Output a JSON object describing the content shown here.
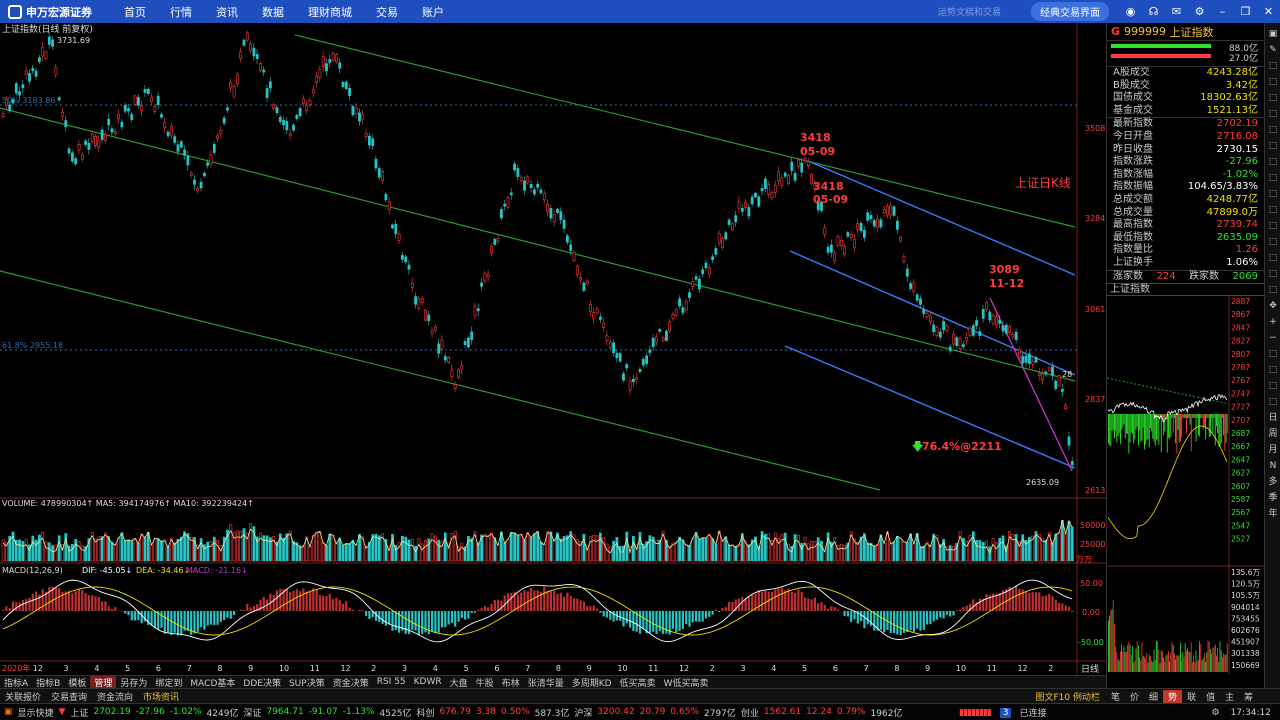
{
  "nav": {
    "logo": "申万宏源证券",
    "items": [
      "首页",
      "行情",
      "资讯",
      "数据",
      "理财商城",
      "交易",
      "账户"
    ],
    "hint": "运势文稿和交易",
    "classic_button": "经典交易界面",
    "icons": [
      "app-icon",
      "headset-icon",
      "mail-icon",
      "gear-icon",
      "minimize-icon",
      "restore-icon",
      "close-icon"
    ]
  },
  "chart": {
    "title": "上证指数(日线 前复权)",
    "high_label": "3731.69",
    "low_label": "2635.09",
    "fib50_label": "50% 3183.86",
    "fib618_label": "61.8% 2955.18",
    "right_title": "上证日K线",
    "ann1": {
      "value": "3418",
      "date": "05-09"
    },
    "ann2": {
      "value": "3418",
      "date": "05-09"
    },
    "ann3": {
      "value": "3089",
      "date": "11-12"
    },
    "fib_target": "76.4%@2211",
    "edge_label": "28",
    "y_ticks": [
      "3508",
      "3284",
      "3061",
      "2837",
      "2613"
    ],
    "x_ticks": [
      "2020年",
      "12",
      "3",
      "4",
      "5",
      "6",
      "7",
      "8",
      "9",
      "10",
      "11",
      "12",
      "2",
      "3",
      "4",
      "5",
      "6",
      "7",
      "8",
      "9",
      "10",
      "11",
      "12",
      "2",
      "3",
      "4",
      "5",
      "6",
      "7",
      "8",
      "9",
      "10",
      "11",
      "12",
      "2"
    ],
    "period": "日线"
  },
  "volume": {
    "header": "VOLUME: 478990304↑  MA5: 394174976↑  MA10: 392239424↑",
    "y_ticks": [
      "50000",
      "25000"
    ],
    "unit": "万万"
  },
  "macd": {
    "header_name": "MACD(12,26,9)",
    "dif": "DIF: -45.05↓",
    "dea": "DEA: -34.46↓",
    "macd": "MACD: -21.16↓",
    "y_ticks": [
      "50.00",
      "0.00",
      "-50.00"
    ]
  },
  "right_panel": {
    "code": "999999",
    "name": "上证指数",
    "bar_pct1": "88.0亿",
    "bar_pct2": "27.0亿",
    "turnover": [
      {
        "k": "A股成交",
        "v": "4243.28亿"
      },
      {
        "k": "B股成交",
        "v": "3.42亿"
      },
      {
        "k": "国债成交",
        "v": "18302.63亿"
      },
      {
        "k": "基金成交",
        "v": "1521.13亿"
      }
    ],
    "quote": [
      {
        "k": "最新指数",
        "v": "2702.19",
        "c": "red"
      },
      {
        "k": "今日开盘",
        "v": "2716.08",
        "c": "red"
      },
      {
        "k": "昨日收盘",
        "v": "2730.15",
        "c": "white"
      },
      {
        "k": "指数涨跌",
        "v": "-27.96",
        "c": "green"
      },
      {
        "k": "指数涨幅",
        "v": "-1.02%",
        "c": "green"
      },
      {
        "k": "指数振幅",
        "v": "104.65/3.83%",
        "c": "white"
      },
      {
        "k": "总成交额",
        "v": "4248.77亿",
        "c": "yellow"
      },
      {
        "k": "总成交量",
        "v": "47899.0万",
        "c": "yellow"
      },
      {
        "k": "最高指数",
        "v": "2739.74",
        "c": "red"
      },
      {
        "k": "最低指数",
        "v": "2635.09",
        "c": "green"
      },
      {
        "k": "指数量比",
        "v": "1.26",
        "c": "red"
      },
      {
        "k": "上证换手",
        "v": "1.06%",
        "c": "white"
      }
    ],
    "updown": {
      "up_label": "涨家数",
      "up": "224",
      "down_label": "跌家数",
      "down": "2069"
    },
    "mini_title": "上证指数",
    "mini_ticks": [
      "2887",
      "2867",
      "2847",
      "2827",
      "2807",
      "2787",
      "2767",
      "2747",
      "2727",
      "2707",
      "2687",
      "2667",
      "2647",
      "2627",
      "2607",
      "2587",
      "2567",
      "2547",
      "2527",
      "135.6万",
      "120.5万",
      "105.5万",
      "904014",
      "753455",
      "602676",
      "451907",
      "301338",
      "150669"
    ],
    "tabs": [
      "笔",
      "价",
      "细",
      "势",
      "联",
      "值",
      "主",
      "筹"
    ],
    "active_tab": "势"
  },
  "far_right": [
    "日",
    "周",
    "月",
    "N",
    "多",
    "季",
    "年"
  ],
  "tabs_row1": [
    "指标A",
    "指标B",
    "模板",
    "管理",
    "另存为",
    "绑定到",
    "MACD基本",
    "DDE决策",
    "SUP决策",
    "资金决策",
    "RSI 55",
    "KDWR",
    "大盘",
    "牛股",
    "布林",
    "张清华量",
    "多周期KD",
    "低买高卖",
    "W低买高卖"
  ],
  "tabs_row1_active": "管理",
  "tabs_row2": [
    "关联报价",
    "交易查询",
    "资金流向",
    "市场资讯"
  ],
  "tabs_row2_active": "市场资讯",
  "tabs_row2_right": "图文F10  例动栏",
  "status": {
    "label": "显示快捷",
    "sh": {
      "name": "上证",
      "last": "2702.19",
      "chg": "-27.96",
      "pct": "-1.02%",
      "amt": "4249亿"
    },
    "sz": {
      "name": "深证",
      "last": "7964.71",
      "chg": "-91.07",
      "pct": "-1.13%",
      "amt": "4525亿"
    },
    "kc": {
      "name": "科创",
      "last": "676.79",
      "chg": "3.38",
      "pct": "0.50%",
      "amt": "587.3亿"
    },
    "hs": {
      "name": "沪深",
      "last": "3200.42",
      "chg": "20.79",
      "pct": "0.65%",
      "amt": "2797亿"
    },
    "cy": {
      "name": "创业",
      "last": "1562.61",
      "chg": "12.24",
      "pct": "0.79%",
      "amt": "1962亿"
    },
    "connected": "已连接",
    "conn_num": "3",
    "time": "17:34:12"
  },
  "colors": {
    "up": "#ff3c3c",
    "down": "#2ee22e",
    "nav": "#1f4fbf",
    "channel_green": "#2a9a2a",
    "channel_blue": "#3a7bff"
  }
}
